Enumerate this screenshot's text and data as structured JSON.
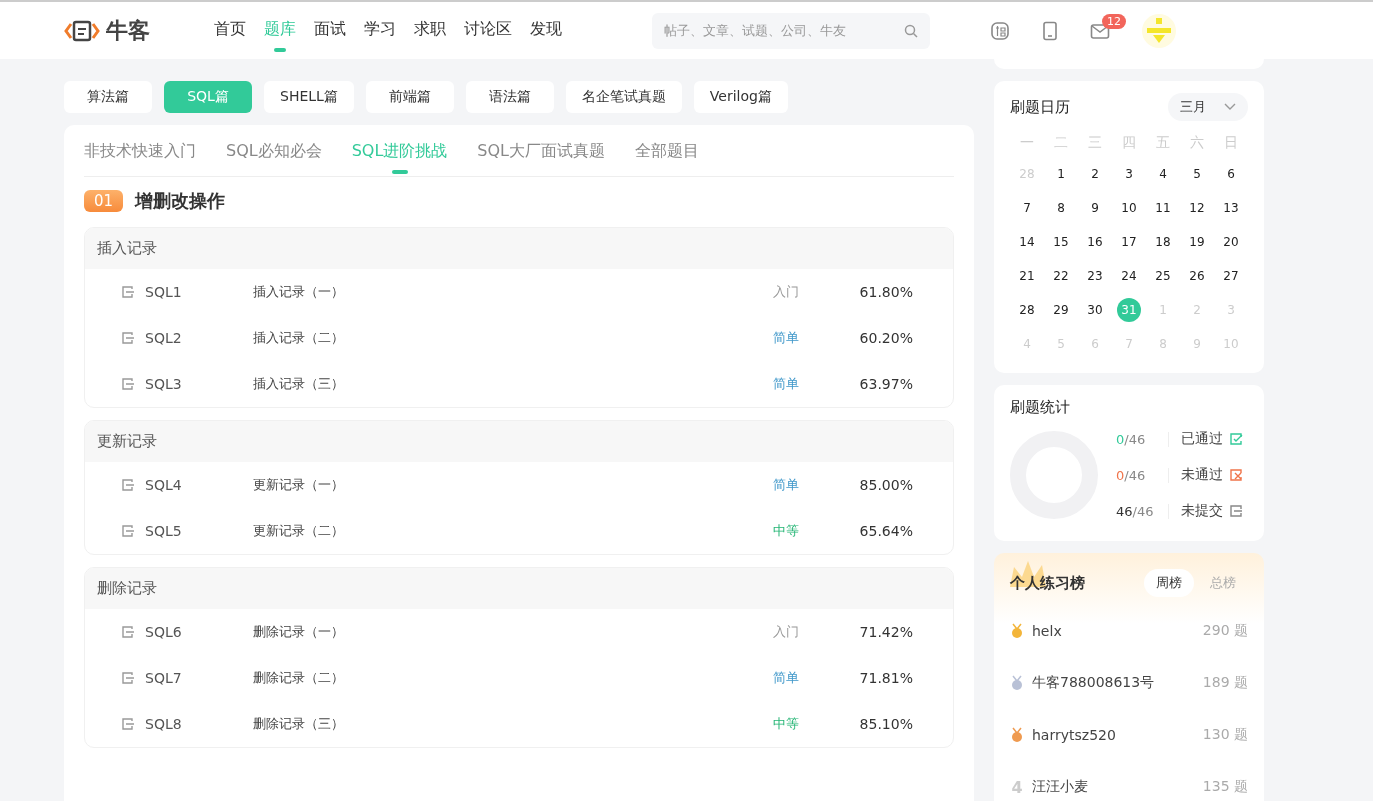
{
  "nav": {
    "logo": "牛客",
    "items": [
      {
        "label": "首页",
        "selected": false
      },
      {
        "label": "题库",
        "selected": true
      },
      {
        "label": "面试",
        "selected": false
      },
      {
        "label": "学习",
        "selected": false
      },
      {
        "label": "求职",
        "selected": false
      },
      {
        "label": "讨论区",
        "selected": false
      },
      {
        "label": "发现",
        "selected": false
      }
    ],
    "search": {
      "placeholder": "帖子、文章、试题、公司、牛友"
    },
    "message_badge": "12"
  },
  "categories": [
    {
      "label": "算法篇",
      "selected": false
    },
    {
      "label": "SQL篇",
      "selected": true
    },
    {
      "label": "SHELL篇",
      "selected": false
    },
    {
      "label": "前端篇",
      "selected": false
    },
    {
      "label": "语法篇",
      "selected": false
    },
    {
      "label": "名企笔试真题",
      "selected": false
    },
    {
      "label": "Verilog篇",
      "selected": false
    }
  ],
  "subtabs": [
    {
      "label": "非技术快速入门",
      "selected": false
    },
    {
      "label": "SQL必知必会",
      "selected": false
    },
    {
      "label": "SQL进阶挑战",
      "selected": true
    },
    {
      "label": "SQL大厂面试真题",
      "selected": false
    },
    {
      "label": "全部题目",
      "selected": false
    }
  ],
  "section": {
    "number": "01",
    "title": "增删改操作",
    "groups": [
      {
        "title": "插入记录",
        "rows": [
          {
            "id": "SQL1",
            "title": "插入记录（一）",
            "difficulty": "入门",
            "kind": "intro",
            "rate": "61.80%"
          },
          {
            "id": "SQL2",
            "title": "插入记录（二）",
            "difficulty": "简单",
            "kind": "easy",
            "rate": "60.20%"
          },
          {
            "id": "SQL3",
            "title": "插入记录（三）",
            "difficulty": "简单",
            "kind": "easy",
            "rate": "63.97%"
          }
        ]
      },
      {
        "title": "更新记录",
        "rows": [
          {
            "id": "SQL4",
            "title": "更新记录（一）",
            "difficulty": "简单",
            "kind": "easy",
            "rate": "85.00%"
          },
          {
            "id": "SQL5",
            "title": "更新记录（二）",
            "difficulty": "中等",
            "kind": "medium",
            "rate": "65.64%"
          }
        ]
      },
      {
        "title": "删除记录",
        "rows": [
          {
            "id": "SQL6",
            "title": "删除记录（一）",
            "difficulty": "入门",
            "kind": "intro",
            "rate": "71.42%"
          },
          {
            "id": "SQL7",
            "title": "删除记录（二）",
            "difficulty": "简单",
            "kind": "easy",
            "rate": "71.81%"
          },
          {
            "id": "SQL8",
            "title": "删除记录（三）",
            "difficulty": "中等",
            "kind": "medium",
            "rate": "85.10%"
          }
        ]
      }
    ]
  },
  "calendar": {
    "title": "刷题日历",
    "month": "三月",
    "weekdays": [
      "一",
      "二",
      "三",
      "四",
      "五",
      "六",
      "日"
    ],
    "days": [
      {
        "label": "28",
        "muted": true,
        "selected": false
      },
      {
        "label": "1",
        "muted": false,
        "selected": false
      },
      {
        "label": "2",
        "muted": false,
        "selected": false
      },
      {
        "label": "3",
        "muted": false,
        "selected": false
      },
      {
        "label": "4",
        "muted": false,
        "selected": false
      },
      {
        "label": "5",
        "muted": false,
        "selected": false
      },
      {
        "label": "6",
        "muted": false,
        "selected": false
      },
      {
        "label": "7",
        "muted": false,
        "selected": false
      },
      {
        "label": "8",
        "muted": false,
        "selected": false
      },
      {
        "label": "9",
        "muted": false,
        "selected": false
      },
      {
        "label": "10",
        "muted": false,
        "selected": false
      },
      {
        "label": "11",
        "muted": false,
        "selected": false
      },
      {
        "label": "12",
        "muted": false,
        "selected": false
      },
      {
        "label": "13",
        "muted": false,
        "selected": false
      },
      {
        "label": "14",
        "muted": false,
        "selected": false
      },
      {
        "label": "15",
        "muted": false,
        "selected": false
      },
      {
        "label": "16",
        "muted": false,
        "selected": false
      },
      {
        "label": "17",
        "muted": false,
        "selected": false
      },
      {
        "label": "18",
        "muted": false,
        "selected": false
      },
      {
        "label": "19",
        "muted": false,
        "selected": false
      },
      {
        "label": "20",
        "muted": false,
        "selected": false
      },
      {
        "label": "21",
        "muted": false,
        "selected": false
      },
      {
        "label": "22",
        "muted": false,
        "selected": false
      },
      {
        "label": "23",
        "muted": false,
        "selected": false
      },
      {
        "label": "24",
        "muted": false,
        "selected": false
      },
      {
        "label": "25",
        "muted": false,
        "selected": false
      },
      {
        "label": "26",
        "muted": false,
        "selected": false
      },
      {
        "label": "27",
        "muted": false,
        "selected": false
      },
      {
        "label": "28",
        "muted": false,
        "selected": false
      },
      {
        "label": "29",
        "muted": false,
        "selected": false
      },
      {
        "label": "30",
        "muted": false,
        "selected": false
      },
      {
        "label": "31",
        "muted": false,
        "selected": true
      },
      {
        "label": "1",
        "muted": true,
        "selected": false
      },
      {
        "label": "2",
        "muted": true,
        "selected": false
      },
      {
        "label": "3",
        "muted": true,
        "selected": false
      },
      {
        "label": "4",
        "muted": true,
        "selected": false
      },
      {
        "label": "5",
        "muted": true,
        "selected": false
      },
      {
        "label": "6",
        "muted": true,
        "selected": false
      },
      {
        "label": "7",
        "muted": true,
        "selected": false
      },
      {
        "label": "8",
        "muted": true,
        "selected": false
      },
      {
        "label": "9",
        "muted": true,
        "selected": false
      },
      {
        "label": "10",
        "muted": true,
        "selected": false
      }
    ]
  },
  "stats": {
    "title": "刷题统计",
    "items": [
      {
        "count": "0",
        "total": "/46",
        "label": "已通过",
        "kind": "passed"
      },
      {
        "count": "0",
        "total": "/46",
        "label": "未通过",
        "kind": "failed"
      },
      {
        "count": "46",
        "total": "/46",
        "label": "未提交",
        "kind": "unsubmitted"
      }
    ]
  },
  "ranking": {
    "title": "个人练习榜",
    "tabs": [
      {
        "label": "周榜",
        "selected": true
      },
      {
        "label": "总榜",
        "selected": false
      }
    ],
    "rows": [
      {
        "kind": "gold",
        "name": "helx",
        "score": "290 题"
      },
      {
        "kind": "silver",
        "name": "牛客788008613号",
        "score": "189 题"
      },
      {
        "kind": "bronze",
        "name": "harrytsz520",
        "score": "130 题"
      },
      {
        "kind": "number",
        "rank": "4",
        "name": "汪汪小麦",
        "score": "135 题"
      }
    ]
  }
}
